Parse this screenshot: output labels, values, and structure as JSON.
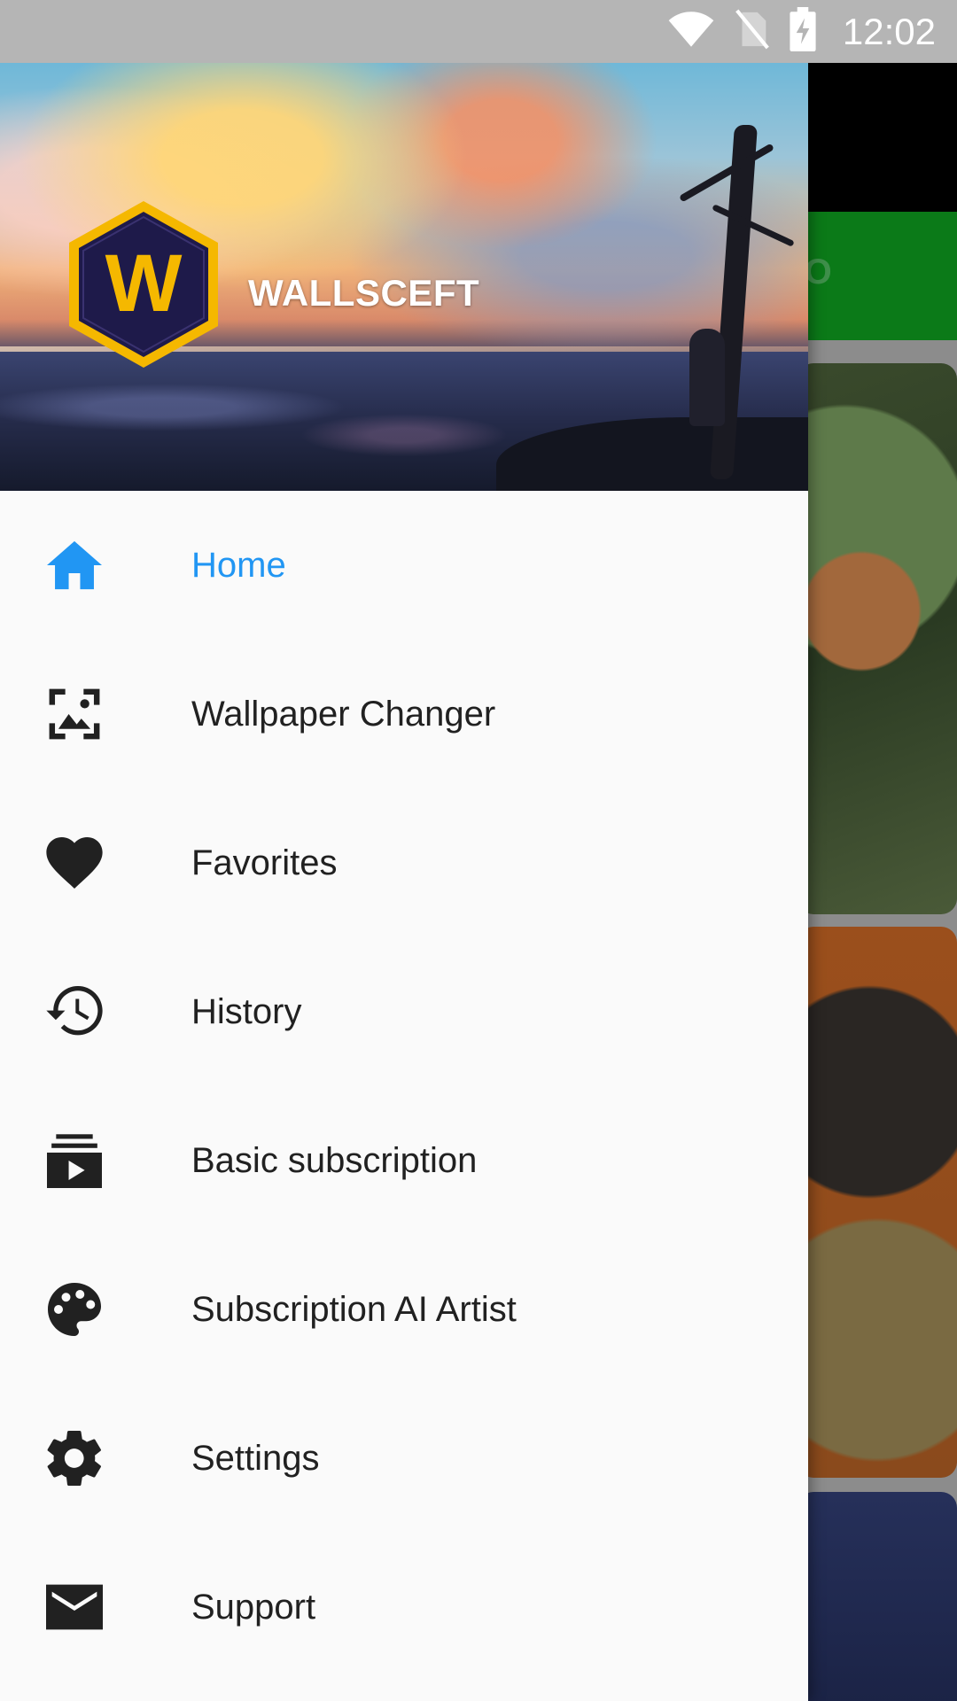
{
  "status_bar": {
    "time": "12:02",
    "icons": [
      "wifi-icon",
      "no-sim-icon",
      "battery-charging-icon"
    ]
  },
  "background": {
    "tab_label_fragment": "DEO"
  },
  "drawer": {
    "header": {
      "title": "WALLSCEFT",
      "logo_letter": "W"
    },
    "items": [
      {
        "label": "Home",
        "icon": "home-icon",
        "active": true
      },
      {
        "label": "Wallpaper Changer",
        "icon": "wallpaper-changer-icon",
        "active": false
      },
      {
        "label": "Favorites",
        "icon": "heart-icon",
        "active": false
      },
      {
        "label": "History",
        "icon": "history-icon",
        "active": false
      },
      {
        "label": "Basic subscription",
        "icon": "subscriptions-icon",
        "active": false
      },
      {
        "label": "Subscription AI Artist",
        "icon": "palette-icon",
        "active": false
      },
      {
        "label": "Settings",
        "icon": "gear-icon",
        "active": false
      },
      {
        "label": "Support",
        "icon": "mail-icon",
        "active": false
      }
    ]
  },
  "colors": {
    "active": "#2196f3",
    "text": "#212121",
    "icon": "#212121",
    "drawer_bg": "#fafafa",
    "status_bar": "#b5b5b5",
    "tab_bar": "#0b7a18",
    "logo_gold": "#f5b800",
    "logo_dark": "#1e1a4a"
  }
}
